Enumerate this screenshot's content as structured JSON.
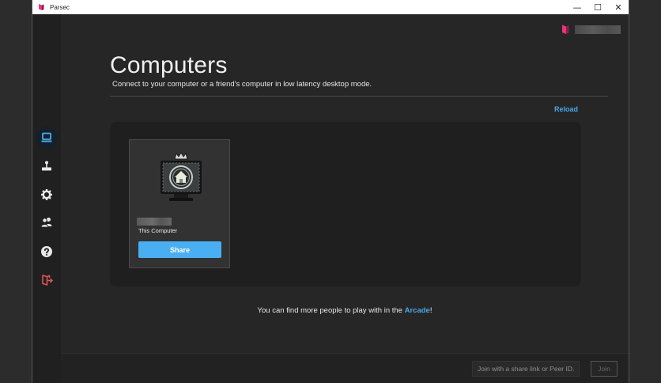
{
  "window": {
    "title": "Parsec",
    "controls": {
      "minimize": "—",
      "maximize": "☐",
      "close": "✕"
    }
  },
  "sidebar": {
    "items": [
      {
        "icon": "computer-icon",
        "active": true
      },
      {
        "icon": "arcade-joystick-icon",
        "active": false
      },
      {
        "icon": "gear-icon",
        "active": false
      },
      {
        "icon": "friends-icon",
        "active": false
      },
      {
        "icon": "help-icon",
        "active": false
      },
      {
        "icon": "logout-icon",
        "active": false
      }
    ]
  },
  "header": {
    "title": "Computers",
    "subtitle": "Connect to your computer or a friend's computer in low latency desktop mode.",
    "reload_label": "Reload"
  },
  "computers": [
    {
      "label": "This Computer",
      "share_label": "Share"
    }
  ],
  "footer_note": {
    "prefix": "You can find more people to play with in the ",
    "link": "Arcade",
    "suffix": "!"
  },
  "join": {
    "placeholder": "Join with a share link or Peer ID.",
    "button_label": "Join"
  },
  "colors": {
    "accent": "#4aaef2",
    "link": "#4aa8e6",
    "brand": "#e8357a",
    "logout": "#e05555"
  }
}
